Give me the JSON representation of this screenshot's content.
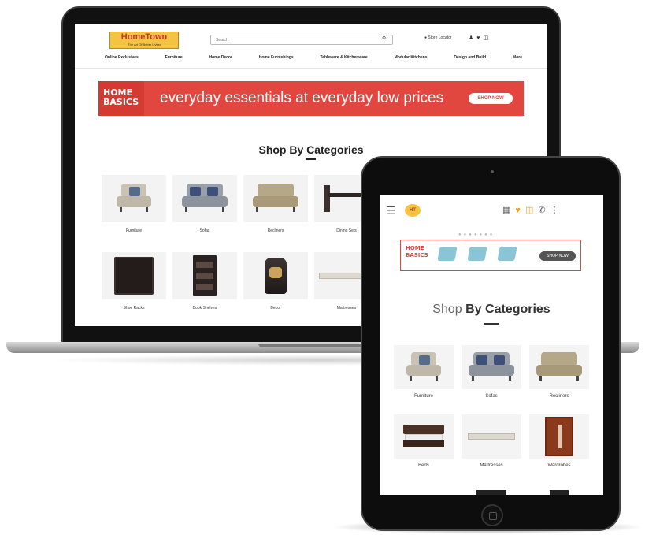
{
  "desktop": {
    "logo": {
      "name": "HomeTown",
      "tagline": "The Art Of Better Living"
    },
    "search": {
      "placeholder": "Search"
    },
    "store_locator": "Store Locator",
    "nav": [
      "Online Exclusives",
      "Furniture",
      "Home Decor",
      "Home Furnishings",
      "Tableware & Kitchenware",
      "Modular Kitchens",
      "Design and Build",
      "More"
    ],
    "banner": {
      "brand_line1": "HOME",
      "brand_line2": "BASICS",
      "text": "everyday essentials at everyday low prices",
      "button": "SHOP NOW"
    },
    "section_title": "Shop By Categories",
    "categories": [
      "Furniture",
      "Sofas",
      "Recliners",
      "Dining Sets",
      "Shoe Racks",
      "Book Shelves",
      "Decor",
      "Mattresses"
    ]
  },
  "tablet": {
    "logo": "HT",
    "banner": {
      "brand_line1": "HOME",
      "brand_line2": "BASICS",
      "button": "SHOP NOW"
    },
    "section_title_light": "Shop",
    "section_title_bold": "By Categories",
    "categories": [
      "Furniture",
      "Sofas",
      "Recliners",
      "Beds",
      "Mattresses",
      "Wardrobes"
    ]
  },
  "colors": {
    "brand_red": "#e2473f",
    "logo_yellow": "#f5c342"
  }
}
